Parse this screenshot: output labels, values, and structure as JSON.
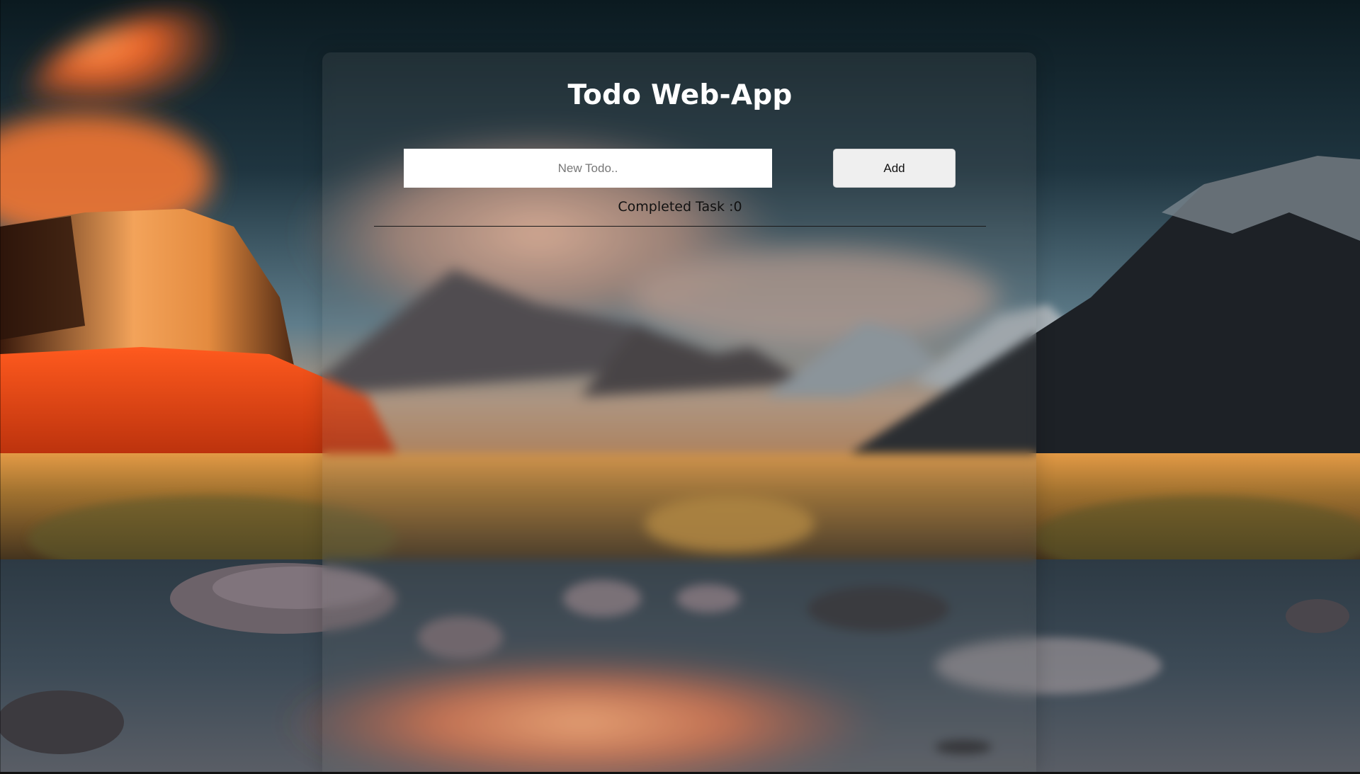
{
  "app": {
    "title": "Todo Web-App"
  },
  "form": {
    "input_value": "",
    "input_placeholder": "New Todo..",
    "add_label": "Add"
  },
  "status": {
    "completed_text": "Completed Task :0"
  },
  "colors": {
    "title_text": "#ffffff",
    "button_bg": "#efefef",
    "input_bg": "#ffffff",
    "divider": "#1a1a1a"
  }
}
